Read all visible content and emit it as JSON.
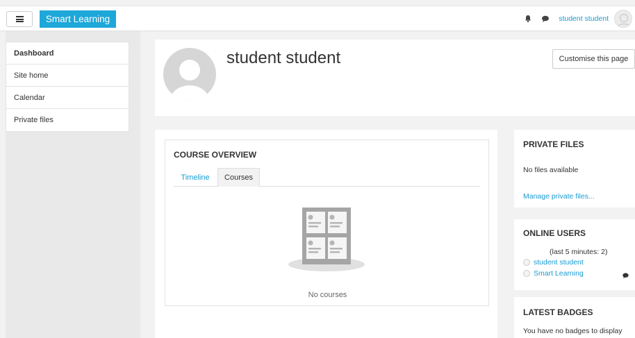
{
  "navbar": {
    "brand": "Smart Learning",
    "username": "student student",
    "icons": [
      "menu-icon",
      "bell-icon",
      "chat-icon",
      "user-avatar"
    ]
  },
  "sidebar": {
    "items": [
      {
        "label": "Dashboard",
        "active": true
      },
      {
        "label": "Site home",
        "active": false
      },
      {
        "label": "Calendar",
        "active": false
      },
      {
        "label": "Private files",
        "active": false
      }
    ]
  },
  "header": {
    "name": "student student",
    "customise_label": "Customise this page"
  },
  "course_overview": {
    "title": "COURSE OVERVIEW",
    "tabs": [
      {
        "label": "Timeline",
        "active": false
      },
      {
        "label": "Courses",
        "active": true
      }
    ],
    "empty_text": "No courses"
  },
  "private_files": {
    "title": "PRIVATE FILES",
    "empty_text": "No files available",
    "manage_link": "Manage private files..."
  },
  "online_users": {
    "title": "ONLINE USERS",
    "subtitle": "(last 5 minutes: 2)",
    "users": [
      "student student",
      "Smart Learning"
    ]
  },
  "latest_badges": {
    "title": "LATEST BADGES",
    "empty_text": "You have no badges to display"
  },
  "colors": {
    "accent": "#1ea7d9",
    "link": "#1a9bd1",
    "page_bg": "#f2f2f2"
  }
}
